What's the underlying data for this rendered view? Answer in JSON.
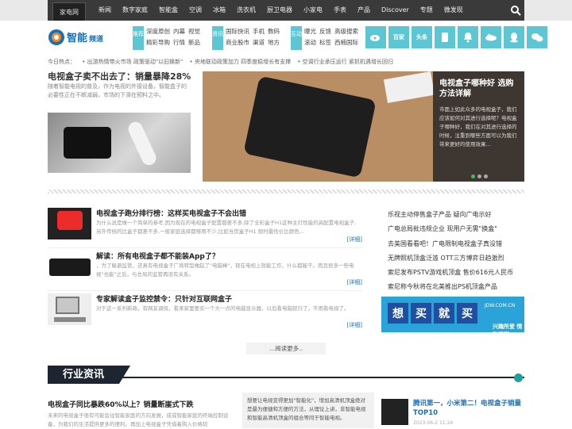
{
  "topbar": {
    "brand": "家电网",
    "nav": [
      "新闻",
      "数字家庭",
      "智能盒",
      "空调",
      "冰箱",
      "洗衣机",
      "厨卫电器",
      "小家电",
      "手表",
      "产品",
      "Discover",
      "专题",
      "微发现"
    ]
  },
  "header": {
    "logo_text": "智能",
    "logo_sub": "频道",
    "categories": [
      {
        "tag": "推荐",
        "rows": [
          [
            "深度原创",
            "内幕",
            "视觉"
          ],
          [
            "精彩导购",
            "行情",
            "新品"
          ]
        ]
      },
      {
        "tag": "资讯",
        "rows": [
          [
            "国际快讯",
            "手机",
            "数码"
          ],
          [
            "商业股市",
            "渠道",
            "地方"
          ]
        ]
      },
      {
        "tag": "互动",
        "rows": [
          [
            "曝光",
            "反馈",
            "高级搜索"
          ],
          [
            "滚动",
            "标签",
            "西楠国际"
          ]
        ]
      }
    ],
    "socials": [
      "微博",
      "百家",
      "头条",
      "",
      "",
      "",
      "",
      "微信"
    ]
  },
  "hotline": {
    "label": "今日热点：",
    "items": [
      "• 出游热情带火市场 政策驱动\"以旧换新\"",
      "• 央地联动政策加力 四季度稳增长有支撑",
      "• 空调行业承压运行 紧抓机遇增长回归"
    ]
  },
  "lead": {
    "title": "电视盒子卖不出去了：销量暴降28%",
    "desc": "随着智能电视的普及，作为电视的外接设备，智能盒子的必要性正在不断减弱，市场的下滑在预料之中。"
  },
  "slide": {
    "title": "电视盒子哪种好 选购方法详解",
    "desc": "市面上如此众多的电视盒子，我们应该如何对其进行选择呢？电视盒子哪种好，我们在对其进行选择的时候，注重到哪些方面可以为我们带来更好的使用效果..."
  },
  "articles": [
    {
      "title": "电视盒子跑分排行榜：这样买电视盒子不会出错",
      "desc": "为什么说是做一个简单的参考,因为现在的电视盒子配置都差不多,除了全彩盒子H1这种主打性能的高配置电视盒子,另外传统的比盒子都差不多,一般家庭选择都够用不少,比如当页盒子H1 限时最性价比颜色...",
      "more": "[详细]"
    },
    {
      "title": "解读：所有电视盒子都不能装App了？",
      "desc": "，为了躲避监管，还真有电视盒子厂商转型做起了\"电脑棒\"，现在电视上就能工作，什么都能干。而且很多一些电视\"也能\"之后，与总局的监管再没有关系。",
      "more": "[详细]"
    },
    {
      "title": "专家解读盒子监控禁令：只针对互联网盒子",
      "desc": "对于这一系列新政，有网友调侃，看来家里要买一个大一点的电脑显示器，以后看电脑就行了，不用看电视了。",
      "more": "[详细]"
    }
  ],
  "side_list": [
    "乐视主动停售盒子产品 疑向广电示好",
    "广电总局批违规企业 现用户无需\"换盒\"",
    "去美国看看吧！广电限制电视盒子真没错",
    "无牌照机顶盒泛滥 OTT三方博弈日趋激烈",
    "索尼发布PSTV游戏机顶盒 售价616元人民币",
    "索尼称今秋将在北美推出PS机顶盒产品"
  ],
  "ad": {
    "chars": [
      "想",
      "买",
      "就",
      "买"
    ],
    "site": "JDW.COM.CN",
    "slogan": "兴趣所爱 情融天下"
  },
  "more_button": "...阅读更多..",
  "section": {
    "title": "行业资讯"
  },
  "news": {
    "title": "电视盒子同比暴跌60%以上？销量断崖式下跌",
    "desc": "未来的电视盒子很有可能会往智能家庭的方向发展，成或智能家庭的终端控制设备，为我们的生活提供更多的便利。再加上电视盒子凭借着购入价格较"
  },
  "quote": "想要让电视变得更加\"智能化\"，增加高清机顶盒绝对是最为便捷和方便的方法，从理论上讲，非智能电视和智能高清机顶盒的组合等同于智能电视。",
  "card": {
    "title": "腾讯第一，小米第二！电视盒子销量TOP10",
    "time": "2023-06-2 11:24"
  }
}
